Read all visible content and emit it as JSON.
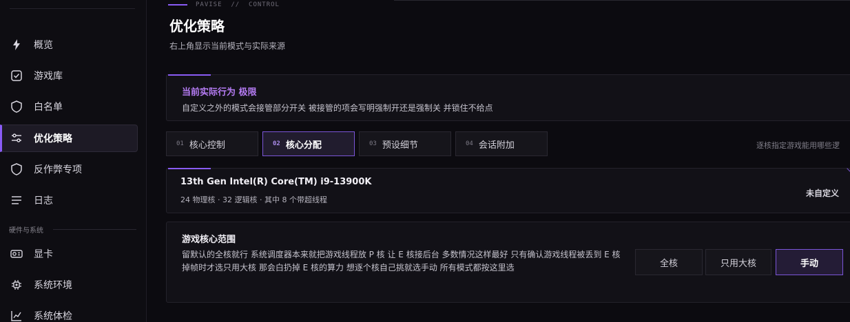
{
  "sidebar": {
    "items": [
      {
        "label": "概览",
        "icon": "bolt-icon"
      },
      {
        "label": "游戏库",
        "icon": "checkbox-icon"
      },
      {
        "label": "白名单",
        "icon": "shield-icon"
      },
      {
        "label": "优化策略",
        "icon": "sliders-icon",
        "active": true
      },
      {
        "label": "反作弊专项",
        "icon": "shield-icon"
      },
      {
        "label": "日志",
        "icon": "list-icon"
      }
    ],
    "section_label": "硬件与系统",
    "hardware_items": [
      {
        "label": "显卡",
        "icon": "gpu-icon"
      },
      {
        "label": "系统环境",
        "icon": "chip-icon"
      },
      {
        "label": "系统体检",
        "icon": "chart-icon"
      }
    ]
  },
  "header": {
    "breadcrumb": "PAVISE  //  CONTROL",
    "title": "优化策略",
    "subtitle": "右上角显示当前模式与实际来源"
  },
  "behavior": {
    "title": "当前实际行为 极限",
    "description": "自定义之外的模式会接管部分开关 被接管的项会写明强制开还是强制关 并锁住不给点"
  },
  "tabs": [
    {
      "num": "01",
      "label": "核心控制"
    },
    {
      "num": "02",
      "label": "核心分配",
      "active": true
    },
    {
      "num": "03",
      "label": "预设细节"
    },
    {
      "num": "04",
      "label": "会话附加"
    }
  ],
  "tab_hint": "逐核指定游戏能用哪些逻",
  "cpu": {
    "name": "13th Gen Intel(R) Core(TM) i9-13900K",
    "detail": "24 物理核 · 32 逻辑核 · 其中 8 个带超线程",
    "status": "未自定义"
  },
  "core_range": {
    "title": "游戏核心范围",
    "description": "留默认的全核就行 系统调度器本来就把游戏线程放 P 核 让 E 核接后台 多数情况这样最好 只有确认游戏线程被丢到 E 核掉帧时才选只用大核 那会白扔掉 E 核的算力 想逐个核自己挑就选手动 所有模式都按这里选",
    "options": [
      {
        "label": "全核"
      },
      {
        "label": "只用大核"
      },
      {
        "label": "手动",
        "active": true
      }
    ]
  },
  "colors": {
    "accent": "#8a5cf6",
    "behavior_title": "#b57cf4",
    "background": "#0c0b10"
  }
}
